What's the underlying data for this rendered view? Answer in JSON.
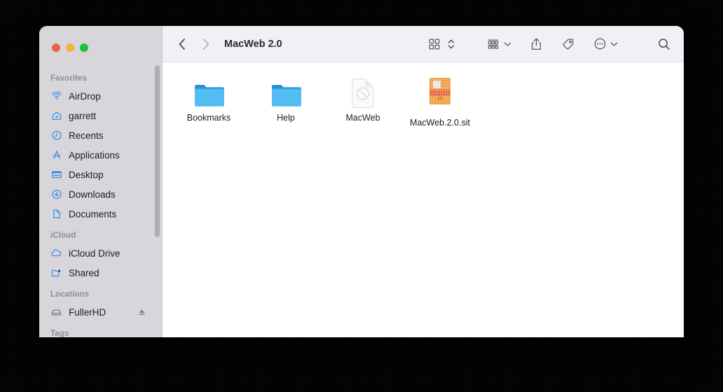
{
  "window": {
    "title": "MacWeb 2.0",
    "traffic_lights": [
      {
        "name": "close",
        "color": "#e8643c"
      },
      {
        "name": "minimize",
        "color": "#f5b13d"
      },
      {
        "name": "maximize",
        "color": "#1fbf34"
      }
    ]
  },
  "toolbar": {
    "back_icon": "chevron-left-icon",
    "forward_icon": "chevron-right-icon",
    "view_icon": "icon-view-grid-icon",
    "view_sort_icon": "chevron-up-down-icon",
    "group_icon": "group-by-list-icon",
    "group_caret_icon": "chevron-down-icon",
    "share_icon": "share-icon",
    "tag_icon": "tag-icon",
    "more_icon": "more-circle-icon",
    "more_caret_icon": "chevron-down-icon",
    "search_icon": "search-icon"
  },
  "sidebar": {
    "sections": [
      {
        "header": "Favorites",
        "items": [
          {
            "label": "AirDrop",
            "icon": "airdrop-icon"
          },
          {
            "label": "garrett",
            "icon": "home-icon"
          },
          {
            "label": "Recents",
            "icon": "clock-icon"
          },
          {
            "label": "Applications",
            "icon": "applications-icon"
          },
          {
            "label": "Desktop",
            "icon": "desktop-icon"
          },
          {
            "label": "Downloads",
            "icon": "downloads-icon"
          },
          {
            "label": "Documents",
            "icon": "document-icon"
          }
        ]
      },
      {
        "header": "iCloud",
        "items": [
          {
            "label": "iCloud Drive",
            "icon": "cloud-icon"
          },
          {
            "label": "Shared",
            "icon": "shared-folder-icon"
          }
        ]
      },
      {
        "header": "Locations",
        "items": [
          {
            "label": "FullerHD",
            "icon": "harddrive-icon",
            "eject": true,
            "eject_icon": "eject-icon"
          }
        ]
      },
      {
        "header": "Tags",
        "items": []
      }
    ]
  },
  "content": {
    "files": [
      {
        "name": "Bookmarks",
        "kind": "folder",
        "icon": "folder-icon"
      },
      {
        "name": "Help",
        "kind": "folder",
        "icon": "folder-icon"
      },
      {
        "name": "MacWeb",
        "kind": "document",
        "icon": "unsupported-document-icon"
      },
      {
        "name": "MacWeb.2.0.sit",
        "kind": "archive",
        "icon": "stuffit-archive-icon",
        "badge_text": "sit"
      }
    ]
  },
  "colors": {
    "sidebar_bg": "#d8d6da",
    "toolbar_bg": "#f2f0f4",
    "content_bg": "#ffffff",
    "accent_blue": "#3d8fea",
    "folder_blue": "#4eb3ef",
    "archive_orange": "#f0a54a"
  }
}
